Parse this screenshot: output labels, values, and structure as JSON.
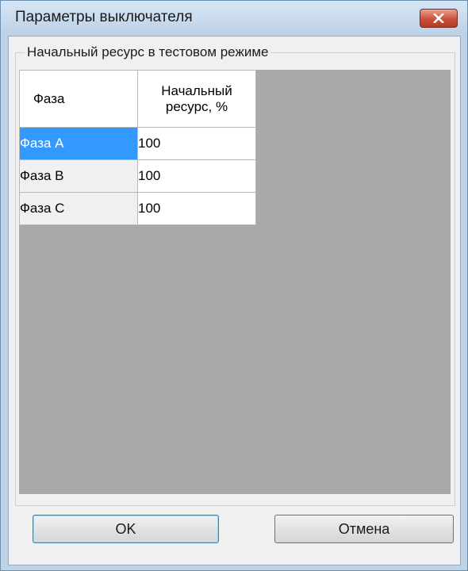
{
  "window": {
    "title": "Параметры выключателя"
  },
  "group": {
    "title": "Начальный ресурс в тестовом режиме"
  },
  "table": {
    "headers": [
      "Фаза",
      "Начальный ресурс, %"
    ],
    "header_line1": "Начальный",
    "header_line2": "ресурс, %",
    "rows": [
      {
        "phase": "Фаза A",
        "value": "100",
        "selected": true
      },
      {
        "phase": "Фаза B",
        "value": "100",
        "selected": false
      },
      {
        "phase": "Фаза C",
        "value": "100",
        "selected": false
      }
    ]
  },
  "buttons": {
    "ok": "OK",
    "cancel": "Отмена"
  },
  "colors": {
    "selection": "#3399ff",
    "grid_background": "#a9a9a9",
    "close_button": "#c9503a"
  }
}
